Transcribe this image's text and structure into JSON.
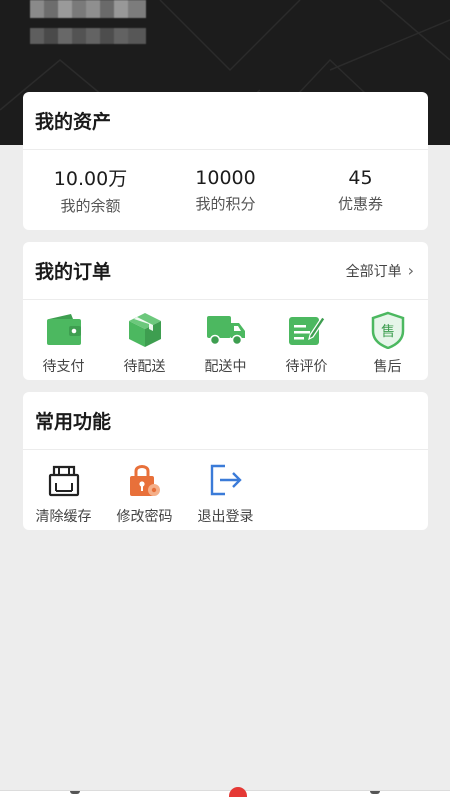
{
  "assets": {
    "title": "我的资产",
    "items": [
      {
        "value": "10.00万",
        "label": "我的余额"
      },
      {
        "value": "10000",
        "label": "我的积分"
      },
      {
        "value": "45",
        "label": "优惠券"
      }
    ]
  },
  "orders": {
    "title": "我的订单",
    "all_label": "全部订单",
    "items": [
      {
        "label": "待支付",
        "icon": "wallet-icon"
      },
      {
        "label": "待配送",
        "icon": "package-icon"
      },
      {
        "label": "配送中",
        "icon": "truck-icon"
      },
      {
        "label": "待评价",
        "icon": "review-icon"
      },
      {
        "label": "售后",
        "icon": "after-sales-icon"
      }
    ]
  },
  "functions": {
    "title": "常用功能",
    "items": [
      {
        "label": "清除缓存",
        "icon": "clear-cache-icon"
      },
      {
        "label": "修改密码",
        "icon": "lock-icon"
      },
      {
        "label": "退出登录",
        "icon": "logout-icon"
      }
    ]
  },
  "colors": {
    "accent_green": "#4cb860",
    "lock_orange": "#e8703a",
    "logout_blue": "#3b7bd8",
    "header_dark": "#1c1c1c",
    "badge_red": "#e53935"
  }
}
